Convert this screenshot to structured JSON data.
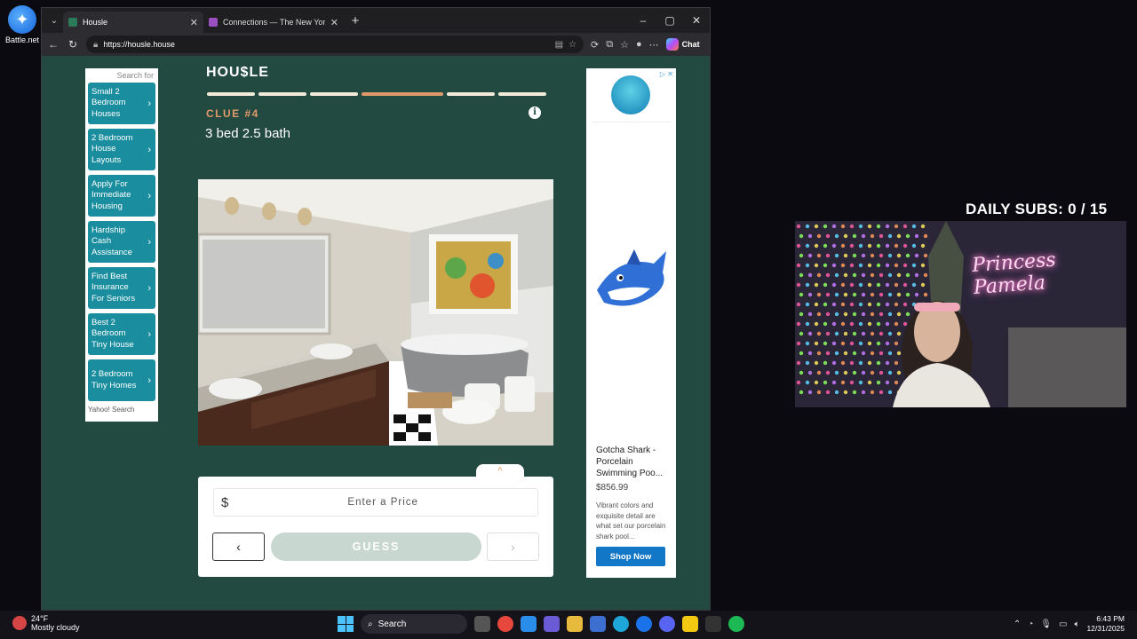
{
  "desktop": {
    "icon_label": "Battle.net"
  },
  "browser": {
    "tabs": [
      {
        "title": "Housle",
        "active": true
      },
      {
        "title": "Connections — The New York Times",
        "active": false
      }
    ],
    "url": "https://housle.house",
    "chat_label": "Chat"
  },
  "left_ad": {
    "search_for": "Search for",
    "items": [
      "Small 2 Bedroom Houses",
      "2 Bedroom House Layouts",
      "Apply For Immediate Housing",
      "Hardship Cash Assistance",
      "Find Best Insurance For Seniors",
      "Best 2 Bedroom Tiny House",
      "2 Bedroom Tiny Homes"
    ],
    "footer": "Yahoo! Search"
  },
  "game": {
    "logo": "HOU$LE",
    "progress": {
      "total_clues": 6,
      "current_clue": 4
    },
    "clue_label": "CLUE #4",
    "clue_text": "3 bed 2.5 bath",
    "info_glyph": "i",
    "price_prefix": "$",
    "price_placeholder": "Enter a Price",
    "guess_label": "GUESS",
    "prev_glyph": "‹",
    "next_glyph": "›",
    "collapse_glyph": "^"
  },
  "right_ad": {
    "product_title": "Gotcha Shark - Porcelain Swimming Poo...",
    "price": "$856.99",
    "description": "Vibrant colors and exquisite detail are what set our porcelain shark pool...",
    "button": "Shop Now"
  },
  "stream": {
    "subs_label": "DAILY SUBS:",
    "subs_value": "0 / 15",
    "neon_sign": "Princess Pamela"
  },
  "taskbar": {
    "weather_temp": "24°F",
    "weather_desc": "Mostly cloudy",
    "search_label": "Search",
    "time": "6:43 PM",
    "date": "12/31/2025"
  },
  "colors": {
    "page_bg": "#234a41",
    "accent_orange": "#e0996b",
    "ad_teal": "#1a8e9e",
    "shop_blue": "#1277c6"
  }
}
